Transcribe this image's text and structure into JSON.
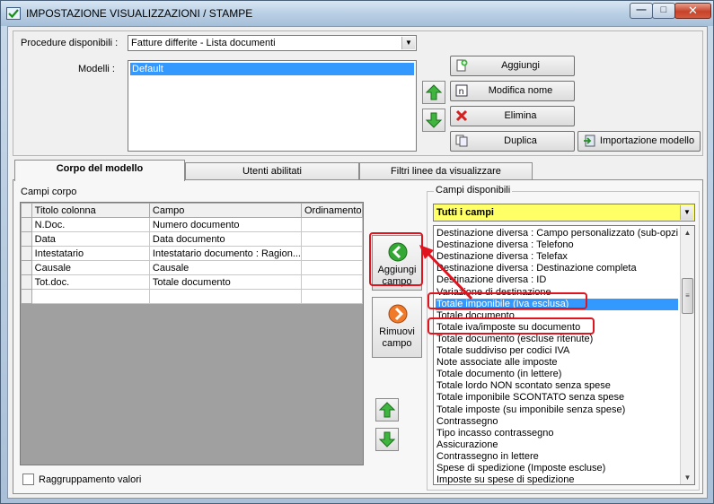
{
  "window": {
    "title": "IMPOSTAZIONE VISUALIZZAZIONI / STAMPE",
    "min_glyph": "—",
    "max_glyph": "□",
    "close_glyph": "✕"
  },
  "procedures": {
    "label": "Procedure disponibili :",
    "selected": "Fatture differite - Lista documenti"
  },
  "models": {
    "label": "Modelli :",
    "items": [
      "Default"
    ]
  },
  "actions": {
    "add": "Aggiungi",
    "rename": "Modifica nome",
    "delete": "Elimina",
    "duplicate": "Duplica",
    "import": "Importazione modello"
  },
  "tabs": [
    "Corpo del modello",
    "Utenti abilitati",
    "Filtri linee da visualizzare"
  ],
  "body_fields": {
    "label": "Campi corpo",
    "columns": [
      "Titolo colonna",
      "Campo",
      "Ordinamento"
    ],
    "rows": [
      [
        "N.Doc.",
        "Numero documento",
        ""
      ],
      [
        "Data",
        "Data documento",
        ""
      ],
      [
        "Intestatario",
        "Intestatario documento : Ragion...",
        ""
      ],
      [
        "Causale",
        "Causale",
        ""
      ],
      [
        "Tot.doc.",
        "Totale documento",
        ""
      ]
    ]
  },
  "field_buttons": {
    "add": "Aggiungi campo",
    "remove": "Rimuovi campo"
  },
  "grouping_label": "Raggruppamento valori",
  "available": {
    "label": "Campi disponibili",
    "filter": "Tutti i campi",
    "items": [
      "Destinazione diversa : Campo personalizzato (sub-opzione",
      "Destinazione diversa : Telefono",
      "Destinazione diversa : Telefax",
      "Destinazione diversa : Destinazione completa",
      "Destinazione diversa : ID",
      "Variazione di destinazione",
      "Totale imponibile (Iva esclusa)",
      "Totale documento",
      "Totale iva/imposte su documento",
      "Totale documento (escluse ritenute)",
      "Totale suddiviso per codici IVA",
      "Note associate alle imposte",
      "Totale documento (in lettere)",
      "Totale lordo NON scontato senza spese",
      "Totale imponibile SCONTATO senza spese",
      "Totale imposte (su imponibile senza spese)",
      "Contrassegno",
      "Tipo incasso contrassegno",
      "Assicurazione",
      "Contrassegno in lettere",
      "Spese di spedizione (Imposte escluse)",
      "Imposte su spese di spedizione"
    ],
    "selected_index": 6
  },
  "colors": {
    "accent_green": "#2e9e2e",
    "selection_blue": "#3399ff",
    "filter_yellow": "#ffff66",
    "annotation_red": "#e0141e"
  }
}
